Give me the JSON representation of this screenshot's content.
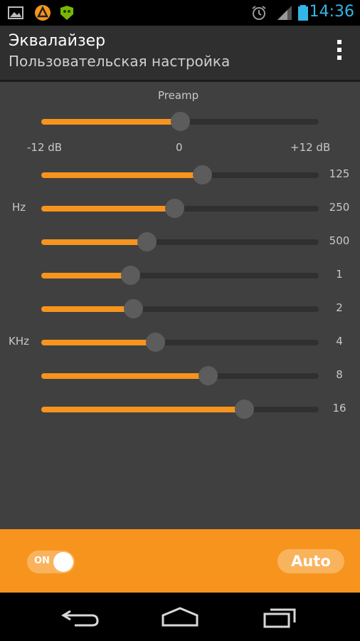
{
  "status_bar": {
    "time": "14:36",
    "icons": [
      "gallery-icon",
      "aimp-icon",
      "android-game-icon",
      "alarm-icon",
      "signal-icon",
      "battery-icon"
    ]
  },
  "action_bar": {
    "title": "Эквалайзер",
    "subtitle": "Пользовательская настройка"
  },
  "equalizer": {
    "preamp_label": "Preamp",
    "preamp_value": 0.5,
    "scale": {
      "min": "-12 dB",
      "mid": "0",
      "max": "+12 dB"
    },
    "group_labels": {
      "hz": "Hz",
      "khz": "KHz"
    },
    "bands": [
      {
        "label": "125",
        "value": 0.58
      },
      {
        "label": "250",
        "value": 0.48
      },
      {
        "label": "500",
        "value": 0.38
      },
      {
        "label": "1",
        "value": 0.32
      },
      {
        "label": "2",
        "value": 0.33
      },
      {
        "label": "4",
        "value": 0.41
      },
      {
        "label": "8",
        "value": 0.6
      },
      {
        "label": "16",
        "value": 0.73
      }
    ]
  },
  "bottom_bar": {
    "toggle_label": "ON",
    "toggle_on": true,
    "auto_label": "Auto"
  },
  "colors": {
    "accent": "#f7941d",
    "panel": "#404040",
    "clock": "#33b5e5"
  }
}
